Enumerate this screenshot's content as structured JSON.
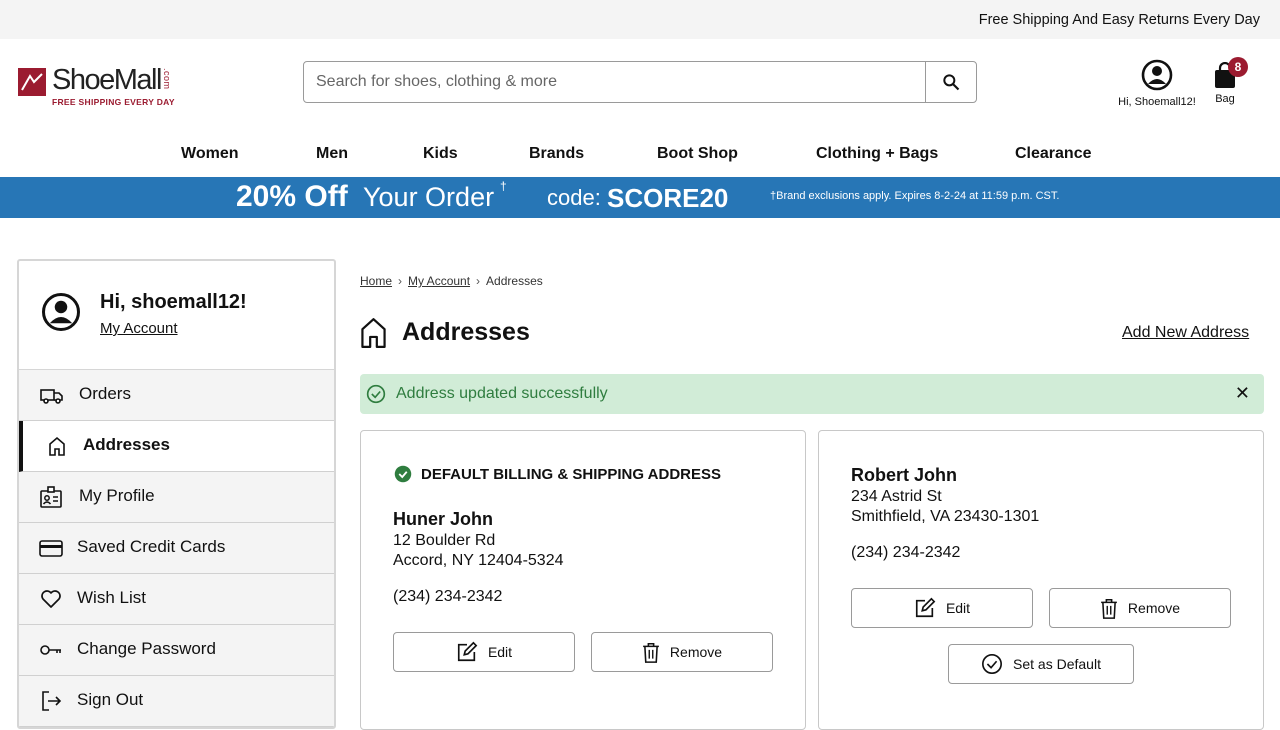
{
  "topbar": {
    "promo_text": "Free Shipping And Easy Returns Every Day"
  },
  "logo": {
    "word": "ShoeMall",
    "suffix": ".com",
    "tagline": "FREE SHIPPING EVERY DAY"
  },
  "search": {
    "placeholder": "Search for shoes, clothing & more",
    "icon": "search-icon"
  },
  "account": {
    "label": "Hi, Shoemall12!",
    "icon": "user-circle-icon"
  },
  "bag": {
    "label": "Bag",
    "count": "8",
    "icon": "shopping-bag-icon"
  },
  "nav": {
    "items": [
      "Women",
      "Men",
      "Kids",
      "Brands",
      "Boot Shop",
      "Clothing + Bags",
      "Clearance"
    ]
  },
  "promo": {
    "discount": "20% Off",
    "rest": "Your Order",
    "dagger": "†",
    "code_label": "code:",
    "code": "SCORE20",
    "fine_print": "†Brand exclusions apply. Expires 8-2-24 at 11:59 p.m. CST.",
    "color": "#2776b6"
  },
  "sidebar": {
    "greeting": "Hi, shoemall12!",
    "account_link": "My Account",
    "items": [
      {
        "label": "Orders",
        "icon": "truck-icon"
      },
      {
        "label": "Addresses",
        "icon": "home-icon",
        "active": true
      },
      {
        "label": "My Profile",
        "icon": "id-card-icon"
      },
      {
        "label": "Saved Credit Cards",
        "icon": "credit-card-icon"
      },
      {
        "label": "Wish List",
        "icon": "heart-icon"
      },
      {
        "label": "Change Password",
        "icon": "key-icon"
      },
      {
        "label": "Sign Out",
        "icon": "sign-out-icon"
      }
    ]
  },
  "breadcrumb": {
    "items": [
      "Home",
      "My Account",
      "Addresses"
    ]
  },
  "page": {
    "title": "Addresses",
    "add_link": "Add New Address"
  },
  "alert": {
    "message": "Address updated successfully",
    "color": "#d1ecd7"
  },
  "addresses": [
    {
      "default_label": "DEFAULT BILLING & SHIPPING ADDRESS",
      "name": "Huner John",
      "street": "12 Boulder Rd",
      "city": "Accord, NY 12404-5324",
      "phone": "(234) 234-2342",
      "edit": "Edit",
      "remove": "Remove"
    },
    {
      "name": "Robert John",
      "street": "234 Astrid St",
      "city": "Smithfield, VA 23430-1301",
      "phone": "(234) 234-2342",
      "edit": "Edit",
      "remove": "Remove",
      "set_default": "Set as Default"
    }
  ]
}
